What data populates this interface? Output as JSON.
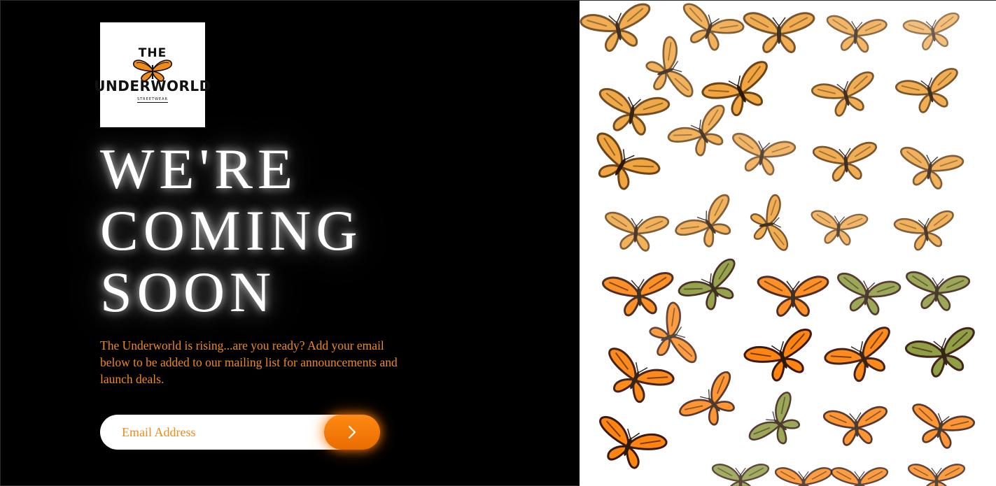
{
  "brand": {
    "logo_line1": "THE",
    "logo_line2": "UNDERWORLD",
    "logo_tagline": "STREETWEAR"
  },
  "hero": {
    "line1": "WE'RE",
    "line2": "COMING",
    "line3": "SOON",
    "description": "The Underworld is rising...are you ready? Add your email below to be added to our mailing list for announcements and launch deals."
  },
  "signup": {
    "placeholder": "Email Address",
    "value": "",
    "submit_icon": "chevron-right-icon"
  },
  "colors": {
    "accent": "#f08a1a",
    "button": "#ff8a14",
    "background": "#000000",
    "gallery_bg": "#ffffff"
  },
  "gallery": {
    "image": "butterfly-pattern",
    "palette": {
      "pale_orange": "#f0a540",
      "pale_dark": "#6b4318",
      "vivid_orange": "#ff8410",
      "vivid_dark": "#3a1a10",
      "green": "#8a9a3a"
    }
  }
}
